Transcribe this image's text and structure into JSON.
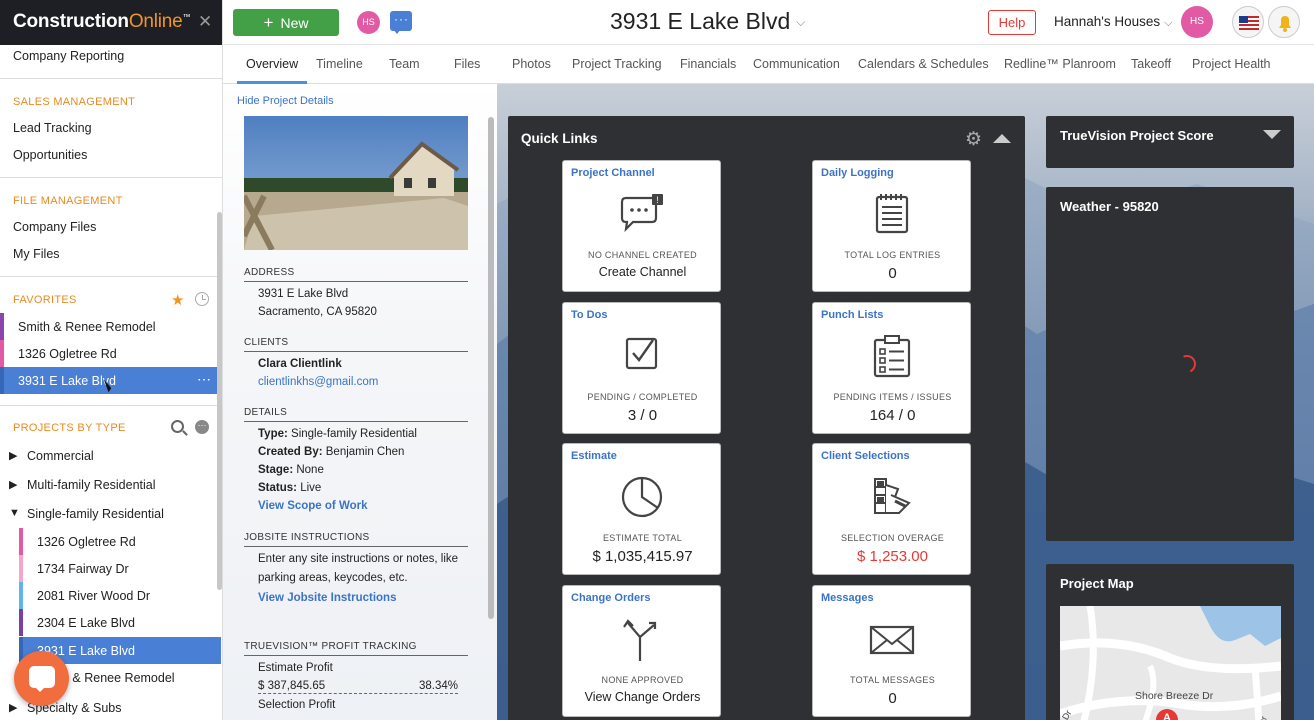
{
  "sidebar": {
    "brand_bold": "Construction",
    "brand_light": "Online",
    "brand_tm": "™",
    "company_reporting": "Company Reporting",
    "sales_header": "SALES MANAGEMENT",
    "lead_tracking": "Lead Tracking",
    "opportunities": "Opportunities",
    "file_header": "FILE MANAGEMENT",
    "company_files": "Company Files",
    "my_files": "My Files",
    "favorites_header": "FAVORITES",
    "favorites": [
      {
        "label": "Smith & Renee Remodel",
        "color": "#8e44ad"
      },
      {
        "label": "1326 Ogletree Rd",
        "color": "#e25aa3"
      },
      {
        "label": "3931 E Lake Blvd",
        "color": "#4a7fd6"
      }
    ],
    "projects_header": "PROJECTS BY TYPE",
    "types": [
      {
        "label": "Commercial",
        "open": false
      },
      {
        "label": "Multi-family Residential",
        "open": false
      },
      {
        "label": "Single-family Residential",
        "open": true
      }
    ],
    "sf_projects": [
      {
        "label": "1326 Ogletree Rd",
        "color": "#e25aa3"
      },
      {
        "label": "1734 Fairway Dr",
        "color": "#f4a6c8"
      },
      {
        "label": "2081 River Wood Dr",
        "color": "#5fb4e8"
      },
      {
        "label": "2304 E Lake Blvd",
        "color": "#7b3fa0"
      },
      {
        "label": "3931 E Lake Blvd",
        "color": "#4a7fd6"
      },
      {
        "label": "Smith & Renee Remodel",
        "color": "#8e44ad"
      }
    ],
    "specialty": "Specialty & Subs"
  },
  "topbar": {
    "new_label": "New",
    "avatar_initials": "HS",
    "project_title": "3931 E Lake Blvd",
    "help_label": "Help",
    "company_name": "Hannah's Houses",
    "user_initials": "HS"
  },
  "tabs": [
    "Overview",
    "Timeline",
    "Team",
    "Files",
    "Photos",
    "Project Tracking",
    "Financials",
    "Communication",
    "Calendars & Schedules",
    "Redline™ Planroom",
    "Takeoff",
    "Project Health"
  ],
  "details": {
    "hide_label": "Hide Project Details",
    "address_header": "ADDRESS",
    "address_line1": "3931 E Lake Blvd",
    "address_line2": "Sacramento, CA 95820",
    "clients_header": "CLIENTS",
    "client_name": "Clara Clientlink",
    "client_email": "clientlinkhs@gmail.com",
    "details_header": "DETAILS",
    "type_label": "Type:",
    "type_value": "Single-family Residential",
    "created_label": "Created By:",
    "created_value": "Benjamin Chen",
    "stage_label": "Stage:",
    "stage_value": "None",
    "status_label": "Status:",
    "status_value": "Live",
    "scope_link": "View Scope of Work",
    "jobsite_header": "JOBSITE INSTRUCTIONS",
    "jobsite_text1": "Enter any site instructions or notes, like",
    "jobsite_text2": "parking areas, keycodes, etc.",
    "jobsite_link": "View Jobsite Instructions",
    "profit_header": "TRUEVISION™ PROFIT TRACKING",
    "estimate_profit_label": "Estimate Profit",
    "estimate_profit_value": "$ 387,845.65",
    "estimate_profit_pct": "38.34%",
    "selection_profit_label": "Selection Profit"
  },
  "quick_links": {
    "title": "Quick Links",
    "cards": [
      {
        "title": "Project Channel",
        "sub": "NO CHANNEL CREATED",
        "value": "Create Channel",
        "icon": "chat-icon"
      },
      {
        "title": "Daily Logging",
        "sub": "TOTAL LOG ENTRIES",
        "value": "0",
        "icon": "log-icon"
      },
      {
        "title": "To Dos",
        "sub": "PENDING / COMPLETED",
        "value": "3 / 0",
        "icon": "checkbox-icon"
      },
      {
        "title": "Punch Lists",
        "sub": "PENDING ITEMS / ISSUES",
        "value": "164 / 0",
        "icon": "clipboard-icon"
      },
      {
        "title": "Estimate",
        "sub": "ESTIMATE TOTAL",
        "value": "$ 1,035,415.97",
        "icon": "pie-icon"
      },
      {
        "title": "Client Selections",
        "sub": "SELECTION OVERAGE",
        "value": "$ 1,253.00",
        "icon": "swatch-icon"
      },
      {
        "title": "Change Orders",
        "sub": "NONE APPROVED",
        "value": "View Change Orders",
        "icon": "branch-icon"
      },
      {
        "title": "Messages",
        "sub": "TOTAL MESSAGES",
        "value": "0",
        "icon": "envelope-icon"
      }
    ]
  },
  "widgets": {
    "score_title": "TrueVision Project Score",
    "weather_title": "Weather - 95820",
    "map_title": "Project Map",
    "map_street": "Shore Breeze Dr",
    "map_marker": "A",
    "map_dr1": "Dr",
    "map_dr2": "Dr"
  }
}
